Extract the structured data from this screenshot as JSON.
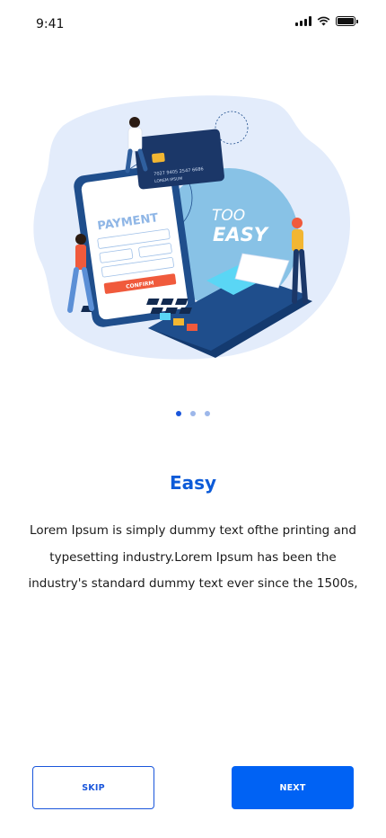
{
  "status_bar": {
    "time": "9:41",
    "icons": [
      "signal-icon",
      "wifi-icon",
      "battery-icon"
    ]
  },
  "illustration": {
    "payment_label": "PAYMENT",
    "too_label": "TOO",
    "easy_label": "EASY",
    "confirm_label": "CONFIRM",
    "card_number_text": "7027 9405 2547 6686",
    "card_name_text": "LOREM IPSUM"
  },
  "pager": {
    "count": 3,
    "active_index": 0
  },
  "content": {
    "title": "Easy",
    "body": "Lorem Ipsum is simply dummy text ofthe printing and typesetting industry.Lorem Ipsum has been the industry's standard dummy text ever since the 1500s,"
  },
  "buttons": {
    "skip_label": "SKIP",
    "next_label": "NEXT"
  },
  "colors": {
    "accent": "#0d5bd8",
    "primary_button": "#0062f4",
    "dot_active": "#1a56db",
    "dot_inactive": "#9db7ea"
  }
}
